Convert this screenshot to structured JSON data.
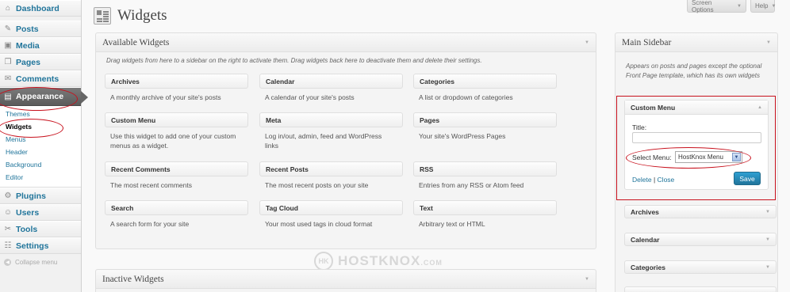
{
  "menu": {
    "dashboard": "Dashboard",
    "posts": "Posts",
    "media": "Media",
    "pages": "Pages",
    "comments": "Comments",
    "appearance": "Appearance",
    "appearance_sub": [
      "Themes",
      "Widgets",
      "Menus",
      "Header",
      "Background",
      "Editor"
    ],
    "plugins": "Plugins",
    "users": "Users",
    "tools": "Tools",
    "settings": "Settings",
    "collapse": "Collapse menu"
  },
  "header": {
    "title": "Widgets",
    "screen_options": "Screen Options",
    "help": "Help"
  },
  "available": {
    "title": "Available Widgets",
    "description": "Drag widgets from here to a sidebar on the right to activate them. Drag widgets back here to deactivate them and delete their settings.",
    "widgets": [
      {
        "name": "Archives",
        "desc": "A monthly archive of your site's posts"
      },
      {
        "name": "Calendar",
        "desc": "A calendar of your site's posts"
      },
      {
        "name": "Categories",
        "desc": "A list or dropdown of categories"
      },
      {
        "name": "Custom Menu",
        "desc": "Use this widget to add one of your custom menus as a widget."
      },
      {
        "name": "Meta",
        "desc": "Log in/out, admin, feed and WordPress links"
      },
      {
        "name": "Pages",
        "desc": "Your site's WordPress Pages"
      },
      {
        "name": "Recent Comments",
        "desc": "The most recent comments"
      },
      {
        "name": "Recent Posts",
        "desc": "The most recent posts on your site"
      },
      {
        "name": "RSS",
        "desc": "Entries from any RSS or Atom feed"
      },
      {
        "name": "Search",
        "desc": "A search form for your site"
      },
      {
        "name": "Tag Cloud",
        "desc": "Your most used tags in cloud format"
      },
      {
        "name": "Text",
        "desc": "Arbitrary text or HTML"
      }
    ]
  },
  "inactive": {
    "title": "Inactive Widgets"
  },
  "sidebar": {
    "title": "Main Sidebar",
    "description": "Appears on posts and pages except the optional Front Page template, which has its own widgets",
    "custom_menu": {
      "title": "Custom Menu",
      "title_label": "Title:",
      "title_value": "",
      "select_label": "Select Menu:",
      "select_value": "HostKnox Menu",
      "delete": "Delete",
      "separator": "|",
      "close": "Close",
      "save": "Save"
    },
    "widgets": [
      "Archives",
      "Calendar",
      "Categories"
    ]
  },
  "watermark": {
    "logo": "HK",
    "text": "HOSTKNOX",
    "suffix": ".COM"
  },
  "colors": {
    "link": "#21759b",
    "active_menu": "#5b5b5b",
    "annotation": "#c8111d",
    "save_button": "#21759b"
  }
}
